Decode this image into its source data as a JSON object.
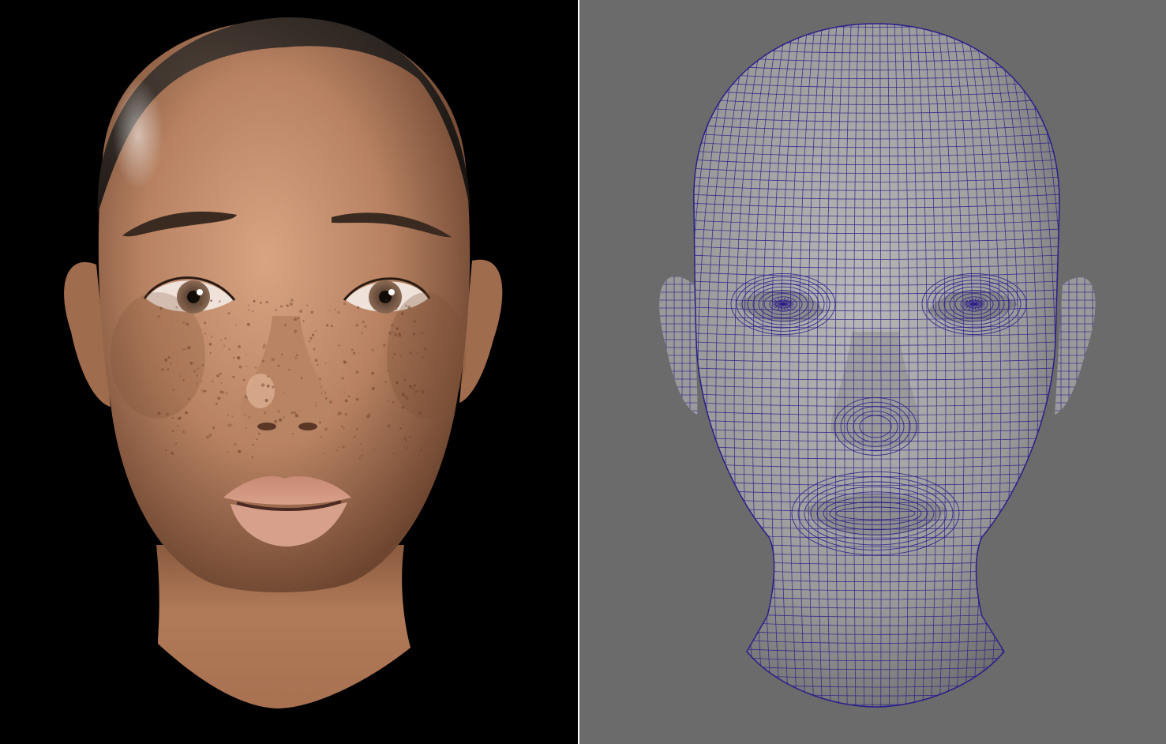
{
  "scene": {
    "render_view": {
      "subject": "rendered-head",
      "background_color": "#000000",
      "skin_color": "#c4906c",
      "skin_shadow_color": "#7a5038",
      "hair_color": "#2a221c",
      "iris_color": "#7a5a46",
      "lip_color": "#c98a76"
    },
    "wireframe_view": {
      "subject": "wireframe-head",
      "background_color": "#6b6b6b",
      "surface_color": "#a3a3a3",
      "wire_color": "#2a1f8a"
    },
    "divider_color": "#ffffff"
  }
}
